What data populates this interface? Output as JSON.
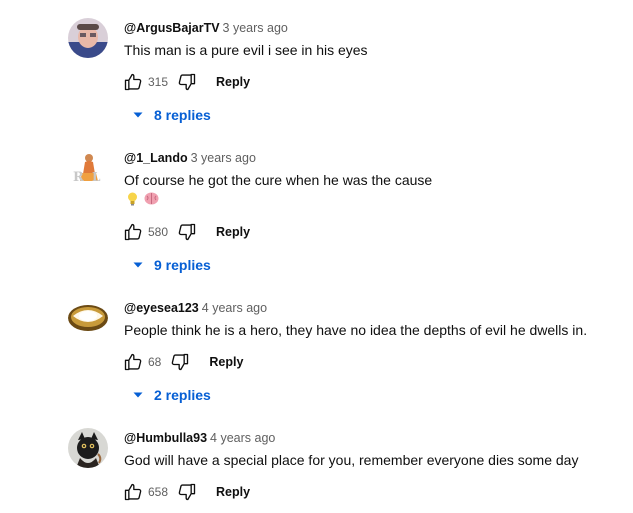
{
  "comments": [
    {
      "author": "@ArgusBajarTV",
      "time": "3 years ago",
      "text": "This man is a pure evil i see in his eyes",
      "likes": "315",
      "reply_label": "Reply",
      "replies_label": "8 replies"
    },
    {
      "author": "@1_Lando",
      "time": "3 years ago",
      "text": "Of course he got the cure when he was the cause",
      "emojis": [
        "lightbulb-emoji",
        "brain-emoji"
      ],
      "likes": "580",
      "reply_label": "Reply",
      "replies_label": "9 replies"
    },
    {
      "author": "@eyesea123",
      "time": "4 years ago",
      "text": "People think he is a hero, they have no idea the depths of evil he dwells in.",
      "likes": "68",
      "reply_label": "Reply",
      "replies_label": "2 replies"
    },
    {
      "author": "@Humbulla93",
      "time": "4 years ago",
      "text": "God will have a special place for you, remember everyone dies some day",
      "likes": "658",
      "reply_label": "Reply"
    }
  ],
  "colors": {
    "link_blue": "#065fd4",
    "secondary_text": "#606060"
  }
}
